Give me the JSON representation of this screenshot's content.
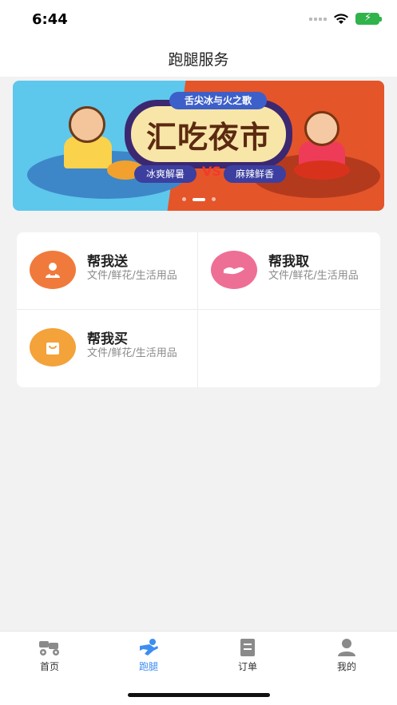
{
  "status_bar": {
    "time": "6:44"
  },
  "nav": {
    "title": "跑腿服务"
  },
  "banner": {
    "ribbon": "舌尖冰与火之歌",
    "title": "汇吃夜市",
    "tag_left": "冰爽解暑",
    "vs": "VS",
    "tag_right": "麻辣鲜香",
    "page_count": 3,
    "active_page": 2
  },
  "services": [
    {
      "title": "帮我送",
      "desc": "文件/鲜花/生活用品",
      "icon": "person-icon",
      "color": "#f07a3c"
    },
    {
      "title": "帮我取",
      "desc": "文件/鲜花/生活用品",
      "icon": "hand-icon",
      "color": "#ee6f95"
    },
    {
      "title": "帮我买",
      "desc": "文件/鲜花/生活用品",
      "icon": "shopping-bag-icon",
      "color": "#f4a23a"
    }
  ],
  "tabs": [
    {
      "label": "首页",
      "icon": "scooter-icon",
      "active": false
    },
    {
      "label": "跑腿",
      "icon": "runner-icon",
      "active": true
    },
    {
      "label": "订单",
      "icon": "order-icon",
      "active": false
    },
    {
      "label": "我的",
      "icon": "profile-icon",
      "active": false
    }
  ],
  "colors": {
    "accent": "#3d8ef0",
    "tab_inactive_icon": "#8a8a8a"
  }
}
